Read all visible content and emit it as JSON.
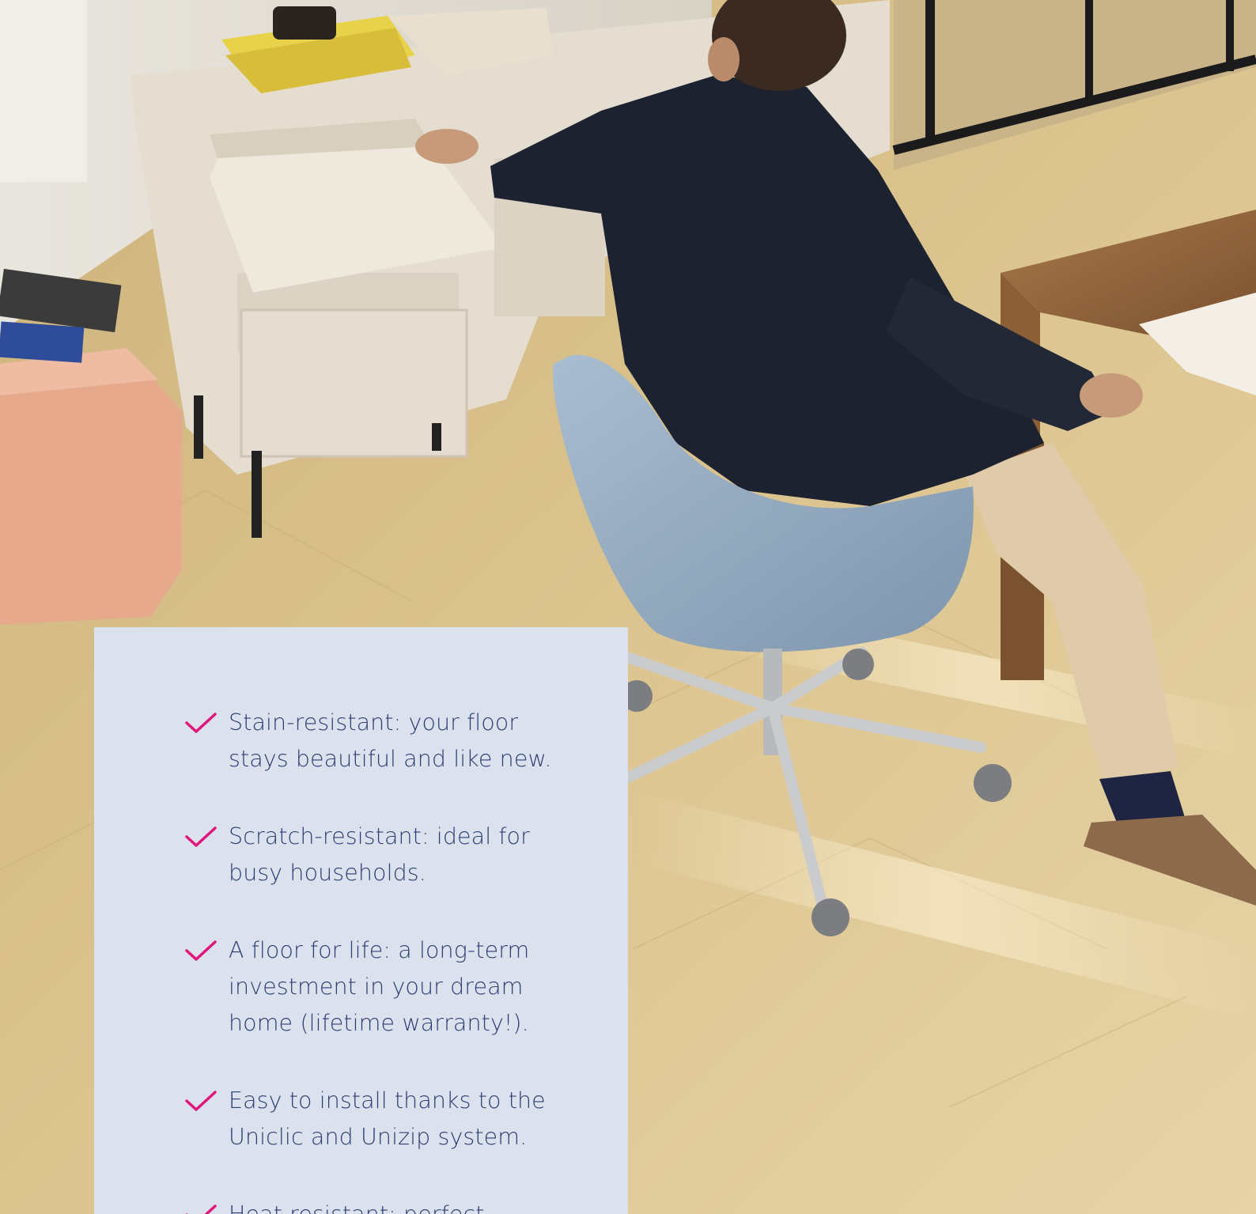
{
  "colors": {
    "card_background": "#dbe2ee",
    "text": "#2d3e73",
    "check_accent": "#e0177a",
    "floor": "#d9c189"
  },
  "icons": {
    "bullet": "checkmark-icon"
  },
  "benefits": [
    {
      "text": "Stain-resistant: your floor stays beautiful and like new."
    },
    {
      "text": "Scratch-resistant: ideal for busy households."
    },
    {
      "text": "A floor for life: a long-term investment in your dream home (lifetime warranty!)."
    },
    {
      "text": "Easy to install thanks to the Uniclic and Unizip system."
    },
    {
      "text": "Heat resistant: perfect"
    }
  ]
}
